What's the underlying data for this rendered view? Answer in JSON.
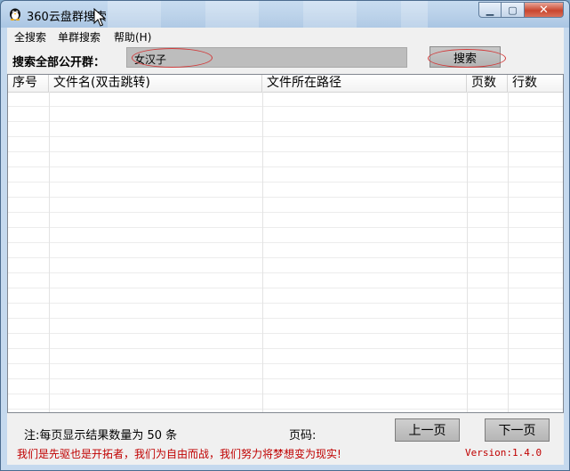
{
  "window": {
    "title": "360云盘群搜索",
    "minimize_symbol": "▁",
    "maximize_symbol": "▢",
    "close_symbol": "✕"
  },
  "menu": {
    "items": [
      {
        "label": "全搜索"
      },
      {
        "label": "单群搜索"
      },
      {
        "label": "帮助(H)"
      }
    ]
  },
  "search": {
    "label": "搜索全部公开群：",
    "value": "女汉子",
    "button_label": "搜索"
  },
  "table": {
    "columns": [
      {
        "label": "序号"
      },
      {
        "label": "文件名(双击跳转)"
      },
      {
        "label": "文件所在路径"
      },
      {
        "label": "页数"
      },
      {
        "label": "行数"
      }
    ],
    "rows": []
  },
  "footer": {
    "note": "注:每页显示结果数量为 50 条",
    "page_label": "页码:",
    "prev_label": "上一页",
    "next_label": "下一页",
    "slogan": "我们是先驱也是开拓者，我们为自由而战，我们努力将梦想变为现实!",
    "version": "Version:1.4.0"
  },
  "colors": {
    "highlight_ellipse": "#d23a3a",
    "slogan_text": "#c00000"
  }
}
